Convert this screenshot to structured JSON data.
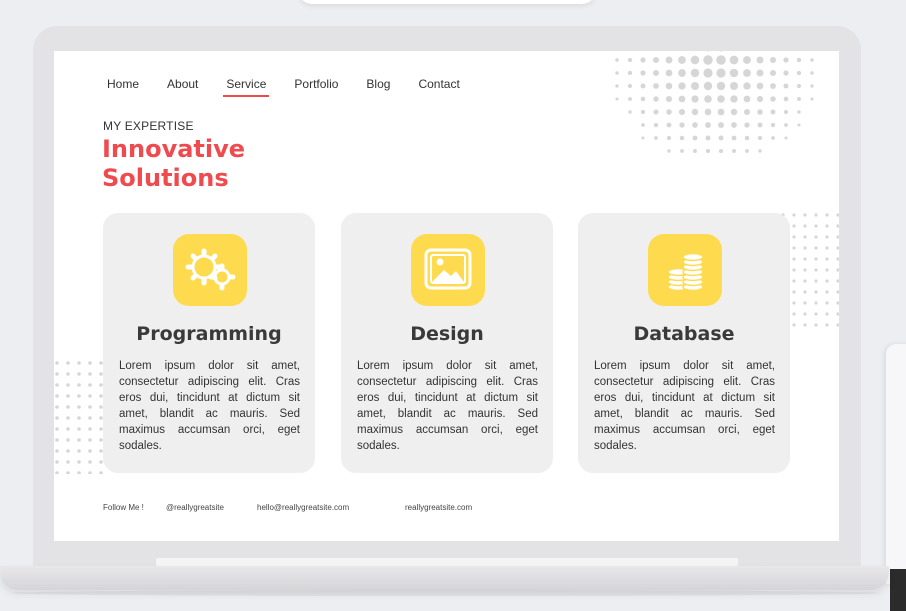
{
  "nav": {
    "items": [
      {
        "label": "Home"
      },
      {
        "label": "About"
      },
      {
        "label": "Service"
      },
      {
        "label": "Portfolio"
      },
      {
        "label": "Blog"
      },
      {
        "label": "Contact"
      }
    ],
    "active": "Service"
  },
  "hero": {
    "eyebrow": "MY EXPERTISE",
    "headline": "Innovative Solutions"
  },
  "cards": [
    {
      "title": "Programming",
      "icon": "gears-icon",
      "body": "Lorem ipsum dolor sit amet, consectetur adipiscing elit. Cras eros dui, tincidunt at dictum sit amet, blandit ac mauris. Sed maximus accumsan orci, eget sodales."
    },
    {
      "title": "Design",
      "icon": "image-icon",
      "body": "Lorem ipsum dolor sit amet, consectetur adipiscing elit. Cras eros dui, tincidunt at dictum sit amet, blandit ac mauris. Sed maximus accumsan orci, eget sodales."
    },
    {
      "title": "Database",
      "icon": "database-coins-icon",
      "body": "Lorem ipsum dolor sit amet, consectetur adipiscing elit. Cras eros dui, tincidunt at dictum sit amet, blandit ac mauris. Sed maximus accumsan orci, eget sodales."
    }
  ],
  "footer": {
    "follow": "Follow Me !",
    "handle": "@reallygreatsite",
    "email": "hello@reallygreatsite.com",
    "website": "reallygreatsite.com"
  },
  "colors": {
    "accent": "#ef4b4f",
    "icon_bg": "#fedb4e",
    "card_bg": "#efefef",
    "dots": "#d6d6d6"
  }
}
